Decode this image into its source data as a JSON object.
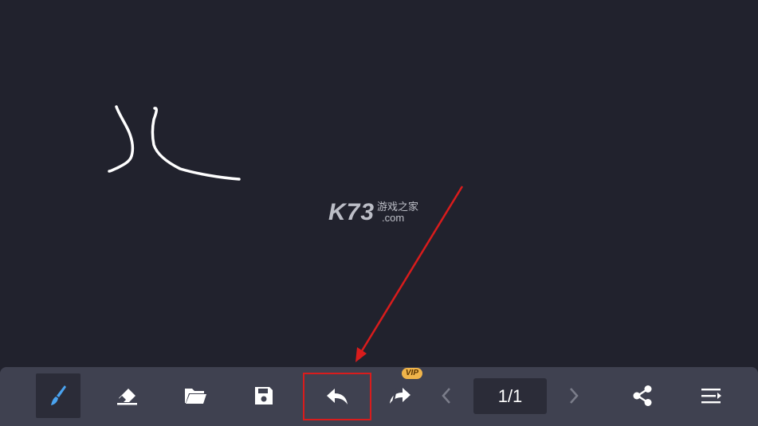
{
  "watermark": {
    "logo": "K73",
    "chinese": "游戏之家",
    "domain": ".com"
  },
  "toolbar": {
    "vip_badge": "VIP",
    "page_indicator": "1/1",
    "tools": [
      {
        "id": "brush",
        "icon": "brush-icon",
        "active": true
      },
      {
        "id": "eraser",
        "icon": "eraser-icon"
      },
      {
        "id": "open",
        "icon": "folder-open-icon"
      },
      {
        "id": "save",
        "icon": "save-icon"
      },
      {
        "id": "undo",
        "icon": "undo-icon",
        "highlighted": true
      },
      {
        "id": "redo",
        "icon": "redo-icon",
        "vip": true
      },
      {
        "id": "prev-page",
        "icon": "chevron-left-icon"
      },
      {
        "id": "next-page",
        "icon": "chevron-right-icon"
      },
      {
        "id": "share",
        "icon": "share-icon"
      },
      {
        "id": "menu",
        "icon": "menu-icon"
      }
    ]
  },
  "colors": {
    "background": "#21222d",
    "toolbar": "#3f4150",
    "active_tool": "#2b2c38",
    "brush_accent": "#4aa3f0",
    "annotation_red": "#d91c1c",
    "vip_gold": "#f0b44a"
  }
}
